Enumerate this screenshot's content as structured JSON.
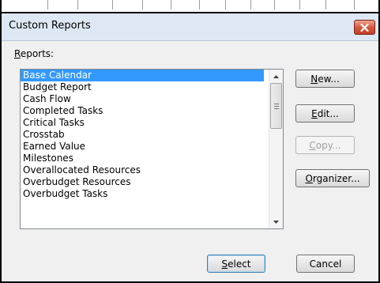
{
  "dialog": {
    "title": "Custom Reports",
    "reports_label": "Reports:",
    "reports_label_accesskey": "R"
  },
  "reports": {
    "selected": "Base Calendar",
    "items": [
      "Base Calendar",
      "Budget Report",
      "Cash Flow",
      "Completed Tasks",
      "Critical Tasks",
      "Crosstab",
      "Earned Value",
      "Milestones",
      "Overallocated Resources",
      "Overbudget Resources",
      "Overbudget Tasks"
    ]
  },
  "buttons": {
    "new": {
      "label": "New...",
      "accesskey": "N",
      "rest": "ew..."
    },
    "edit": {
      "label": "Edit...",
      "accesskey": "E",
      "rest": "dit..."
    },
    "copy": {
      "label": "Copy...",
      "accesskey": "C",
      "rest": "opy...",
      "enabled": false
    },
    "organizer": {
      "label": "Organizer...",
      "accesskey": "O",
      "rest": "rganizer..."
    },
    "select": {
      "label": "Select",
      "accesskey": "S",
      "rest": "elect"
    },
    "cancel": {
      "label": "Cancel"
    }
  },
  "colors": {
    "selection": "#3399ff",
    "titlebar": "#dde8f4",
    "close_button": "#c24227"
  }
}
